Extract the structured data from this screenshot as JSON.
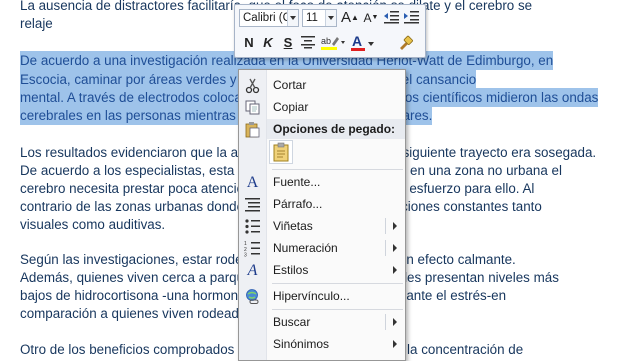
{
  "document": {
    "lines": [
      {
        "text": "La ausencia de distractores facilitaría, que el foco de atención se dilate y el cerebro se",
        "selected": false
      },
      {
        "text": "relaje",
        "selected": false
      },
      {
        "text": "De acuerdo a una investigación realizada en la Universidad Heriot-Watt de Edimburgo, en",
        "selected": true
      },
      {
        "text": "Escocia, caminar por áreas verdes y parques reduce el estrés y el cansancio",
        "selected": true
      },
      {
        "text": "mental. A través de electrodos colocados en el cuero cabelludo, los científicos midieron las ondas",
        "selected": true
      },
      {
        "text": "cerebrales en las personas mientras caminaban por distintos lugares.",
        "selected": true
      },
      {
        "text": "Los resultados evidenciaron que la actividad cerebral durante el siguiente trayecto era sosegada.",
        "selected": false
      },
      {
        "text": "De acuerdo a los especialistas, esta situación se produce porque en una zona no urbana el",
        "selected": false
      },
      {
        "text": "cerebro necesita prestar poca atención y no debe realizar ningún esfuerzo para ello. Al",
        "selected": false
      },
      {
        "text": "contrario de las zonas urbanas donde el cerebro recibe estimulaciones constantes tanto",
        "selected": false
      },
      {
        "text": "visuales como auditivas.",
        "selected": false
      },
      {
        "text": "Según las investigaciones, estar rodeado de naturaleza genera un efecto calmante.",
        "selected": false
      },
      {
        "text": "Además, quienes viven cerca a parques y zonas verdes respirables presentan niveles más",
        "selected": false
      },
      {
        "text": "bajos de hidrocortisona -una hormona relacionada con el estrés- ante el estrés-en",
        "selected": false
      },
      {
        "text": "comparación a quienes viven rodeados de edificaciones.",
        "selected": false
      },
      {
        "text": "Otro de los beneficios comprobados es que la naturaleza mejora la concentración de",
        "selected": false
      }
    ]
  },
  "mini_toolbar": {
    "font_name": "Calibri (C",
    "font_size": "11",
    "grow_font": "A",
    "shrink_font": "A",
    "bold": "N",
    "italic": "K",
    "underline": "S",
    "font_color_letter": "A",
    "highlight_color": "#ffff00",
    "font_color": "#e02020"
  },
  "context_menu": {
    "items": [
      {
        "label": "Cortar",
        "icon": "scissors-icon"
      },
      {
        "label": "Copiar",
        "icon": "copy-icon"
      },
      {
        "label": "Opciones de pegado:",
        "icon": "paste-icon"
      },
      {
        "label": "Fuente...",
        "icon": "font-icon"
      },
      {
        "label": "Párrafo...",
        "icon": "paragraph-icon"
      },
      {
        "label": "Viñetas",
        "icon": "bullets-icon"
      },
      {
        "label": "Numeración",
        "icon": "numbering-icon"
      },
      {
        "label": "Estilos",
        "icon": "styles-icon"
      },
      {
        "label": "Hipervínculo...",
        "icon": "hyperlink-icon"
      },
      {
        "label": "Buscar",
        "icon": ""
      },
      {
        "label": "Sinónimos",
        "icon": ""
      }
    ]
  }
}
